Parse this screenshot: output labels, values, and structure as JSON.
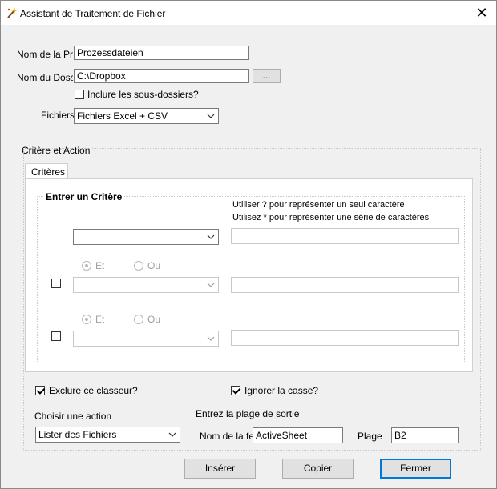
{
  "window": {
    "title": "Assistant de Traitement de Fichier",
    "close_label": "✕"
  },
  "form": {
    "process_name_label": "Nom de la Pro",
    "process_name_value": "Prozessdateien",
    "folder_label": "Nom du Dossi",
    "folder_value": "C:\\Dropbox",
    "browse_label": "...",
    "subfolders_label": "Inclure les sous-dossiers?",
    "files_label": "Fichiers",
    "files_value": "Fichiers Excel + CSV"
  },
  "criteria_group": {
    "title": "Critère et Action",
    "tab_label": "Critères",
    "section_title": "Entrer un Critère",
    "hint1": "Utiliser ? pour représenter un seul caractère",
    "hint2": "Utilisez * pour représenter une série de caractères",
    "radio_and": "Et",
    "radio_or": "Ou",
    "exclude_label": "Exclure ce classeur?",
    "ignore_case_label": "Ignorer la casse?"
  },
  "action": {
    "choose_label": "Choisir une action",
    "action_value": "Lister des Fichiers",
    "output_label": "Entrez la plage de sortie",
    "sheet_label": "Nom de la feu",
    "sheet_value": "ActiveSheet",
    "range_label": "Plage",
    "range_value": "B2"
  },
  "buttons": {
    "insert": "Insérer",
    "copy": "Copier",
    "close": "Fermer"
  }
}
